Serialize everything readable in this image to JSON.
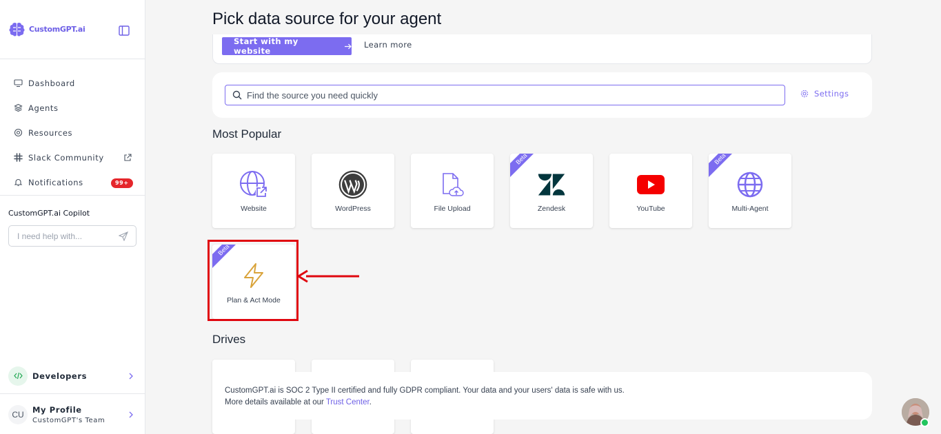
{
  "brand": {
    "name": "CustomGPT.ai",
    "accent": "#7c6cf0"
  },
  "sidebar": {
    "nav": [
      {
        "label": "Dashboard",
        "icon": "monitor-icon"
      },
      {
        "label": "Agents",
        "icon": "layers-icon"
      },
      {
        "label": "Resources",
        "icon": "lifebuoy-icon"
      },
      {
        "label": "Slack Community",
        "icon": "slack-icon"
      },
      {
        "label": "Notifications",
        "icon": "bell-icon",
        "badge": "99+"
      }
    ],
    "copilot": {
      "title": "CustomGPT.ai Copilot",
      "placeholder": "I need help with..."
    },
    "developers": "Developers",
    "profile": {
      "name": "My Profile",
      "team": "CustomGPT's Team",
      "initials": "CU"
    }
  },
  "main": {
    "title": "Pick data source for your agent",
    "start_button": "Start with my website",
    "learn_more": "Learn more",
    "search_placeholder": "Find the source you need quickly",
    "settings": "Settings",
    "most_popular_title": "Most Popular",
    "tiles": [
      {
        "label": "Website",
        "icon": "globe-link-icon",
        "beta": false
      },
      {
        "label": "WordPress",
        "icon": "wordpress-icon",
        "beta": false
      },
      {
        "label": "File Upload",
        "icon": "file-upload-icon",
        "beta": false
      },
      {
        "label": "Zendesk",
        "icon": "zendesk-icon",
        "beta": true
      },
      {
        "label": "YouTube",
        "icon": "youtube-icon",
        "beta": false
      },
      {
        "label": "Multi-Agent",
        "icon": "globe-icon",
        "beta": true
      },
      {
        "label": "Plan & Act Mode",
        "icon": "lightning-icon",
        "beta": true
      }
    ],
    "beta_label": "Beta",
    "drives_title": "Drives",
    "compliance": {
      "line1": "CustomGPT.ai is SOC 2 Type II certified and fully GDPR compliant. Your data and your users' data is safe with us.",
      "line2_prefix": "More details available at our ",
      "trust_link": "Trust Center",
      "line2_suffix": "."
    }
  }
}
